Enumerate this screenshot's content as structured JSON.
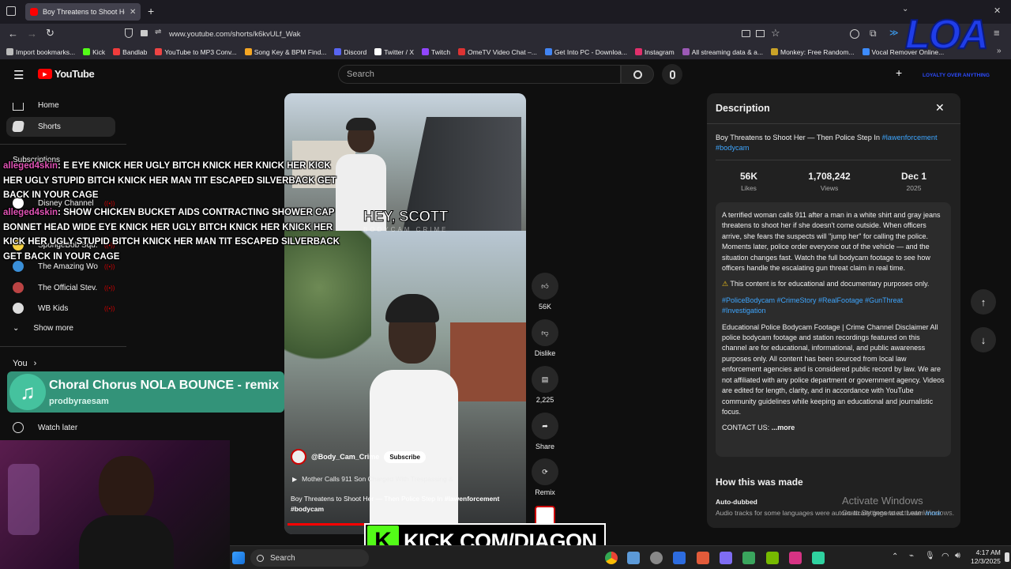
{
  "browser": {
    "tab_title": "Boy Threatens to Shoot Her",
    "url": "www.youtube.com/shorts/k6kvULf_Wak",
    "bookmarks": [
      {
        "label": "Import bookmarks...",
        "color": "#bbbbbb"
      },
      {
        "label": "Kick",
        "color": "#53fc18"
      },
      {
        "label": "Bandlab",
        "color": "#f03c3c"
      },
      {
        "label": "YouTube to MP3 Conv...",
        "color": "#e44"
      },
      {
        "label": "Song Key & BPM Find...",
        "color": "#f5a623"
      },
      {
        "label": "Discord",
        "color": "#5865f2"
      },
      {
        "label": "Twitter / X",
        "color": "#ffffff"
      },
      {
        "label": "Twitch",
        "color": "#9146ff"
      },
      {
        "label": "OmeTV Video Chat –...",
        "color": "#d33"
      },
      {
        "label": "Get Into PC - Downloa...",
        "color": "#4285f4"
      },
      {
        "label": "Instagram",
        "color": "#e1306c"
      },
      {
        "label": "All streaming data & a...",
        "color": "#9b59b6"
      },
      {
        "label": "Monkey: Free Random...",
        "color": "#c9a227"
      },
      {
        "label": "Vocal Remover Online...",
        "color": "#3d8bfd"
      }
    ]
  },
  "youtube": {
    "logo_text": "YouTube",
    "search_placeholder": "Search"
  },
  "sidebar": {
    "home": "Home",
    "shorts": "Shorts",
    "subscriptions": "Subscriptions",
    "channels": [
      {
        "label": "Disney Channel",
        "color": "#ffffff"
      },
      {
        "label": "SpongeBob Squ...",
        "color": "#f5d142"
      },
      {
        "label": "The Amazing Wo...",
        "color": "#3a8fd8"
      },
      {
        "label": "The Official Stev...",
        "color": "#b44"
      },
      {
        "label": "WB Kids",
        "color": "#ddd"
      }
    ],
    "show_more": "Show more",
    "you": "You",
    "watch_later": "Watch later"
  },
  "chat": [
    {
      "user": "alleged4skin",
      "message": ": E EYE KNICK HER UGLY BITCH KNICK HER KNICK HER KICK HER UGLY STUPID BITCH KNICK HER MAN TIT ESCAPED SILVERBACK GET BACK IN YOUR CAGE"
    },
    {
      "user": "alleged4skin",
      "message": ": SHOW CHICKEN BUCKET AIDS CONTRACTING SHOWER CAP BONNET HEAD WIDE EYE KNICK HER UGLY BITCH KNICK HER KNICK HER KICK HER UGLY STUPID BITCH KNICK HER MAN TIT ESCAPED SILVERBACK GET BACK IN YOUR CAGE"
    }
  ],
  "now_playing": {
    "title": "Choral Chorus NOLA BOUNCE - remix",
    "artist": "prodbyraesam"
  },
  "video": {
    "caption": "HEY, SCOTT",
    "watermark": "BODYCAM CRIME",
    "channel": "@Body_Cam_Crime",
    "subscribe": "Subscribe",
    "related": "Mother Calls 911 Son Charged With Trespassing &",
    "title": "Boy Threatens to Shoot Her — Then Police Step In",
    "tag1": "#lawenforcement",
    "tag2": "#bodycam"
  },
  "actions": {
    "likes": "56K",
    "dislike": "Dislike",
    "comments": "2,225",
    "share": "Share",
    "remix": "Remix"
  },
  "description": {
    "heading": "Description",
    "title_text": "Boy Threatens to Shoot Her — Then Police Step In",
    "tag1": "#lawenforcement",
    "tag2": "#bodycam",
    "likes_value": "56K",
    "likes_label": "Likes",
    "views_value": "1,708,242",
    "views_label": "Views",
    "date_value": "Dec 1",
    "date_year": "2025",
    "body": "A terrified woman calls 911 after a man in a white shirt and gray jeans threatens to shoot her if she doesn't come outside. When officers arrive, she fears the suspects will \"jump her\" for calling the police. Moments later, police order everyone out of the vehicle — and the situation changes fast. Watch the full bodycam footage to see how officers handle the escalating gun threat claim in real time.",
    "warning": "This content is for educational and documentary purposes only.",
    "hashtags": "#PoliceBodycam #CrimeStory #RealFootage #GunThreat #Investigation",
    "disclaimer": "Educational Police Bodycam Footage | Crime Channel Disclaimer All police bodycam footage and station recordings featured on this channel are for educational, informational, and public awareness purposes only. All content has been sourced from local law enforcement agencies and is considered public record by law. We are not affiliated with any police department or government agency. Videos are edited for length, clarity, and in accordance with YouTube community guidelines while keeping an educational and journalistic focus.",
    "contact": "CONTACT US:",
    "more": "...more",
    "how_made": "How this was made",
    "auto_dubbed": "Auto-dubbed",
    "auto_text": "Audio tracks for some languages were automatically generated. Learn",
    "auto_more": "more"
  },
  "overlays": {
    "activate_title": "Activate Windows",
    "activate_sub": "Go to Settings to activate Windows.",
    "kick_url": "KICK.COM/DIAGON",
    "logo_text": "LOA",
    "logo_sub": "LOYALTY OVER ANYTHING"
  },
  "taskbar": {
    "search": "Search",
    "time": "4:17 AM",
    "date": "12/3/2025"
  }
}
